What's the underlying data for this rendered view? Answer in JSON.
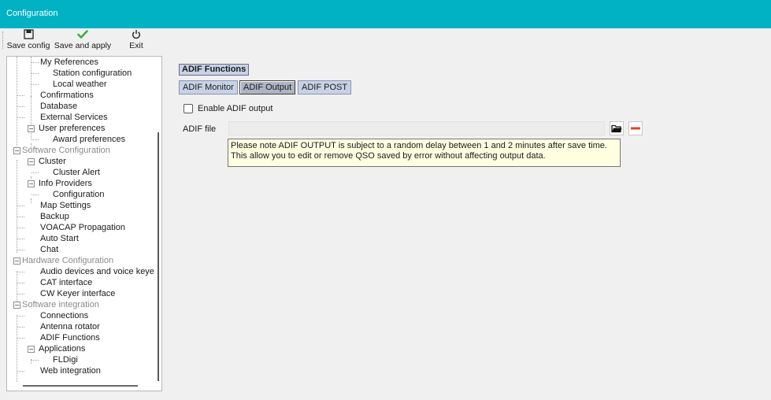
{
  "window": {
    "title": "Configuration"
  },
  "toolbar": {
    "buttons": [
      {
        "id": "save-config",
        "label": "Save config",
        "icon": "floppy-disk-icon"
      },
      {
        "id": "save-and-apply",
        "label": "Save and apply",
        "icon": "checkmark-icon"
      },
      {
        "id": "exit",
        "label": "Exit",
        "icon": "power-icon"
      }
    ]
  },
  "tree": {
    "nodes": [
      {
        "label": "My References",
        "level": 2
      },
      {
        "label": "Station configuration",
        "level": 2
      },
      {
        "label": "Local weather",
        "level": 2
      },
      {
        "label": "Confirmations",
        "level": 1
      },
      {
        "label": "Database",
        "level": 1
      },
      {
        "label": "External Services",
        "level": 1
      },
      {
        "label": "User preferences",
        "level": 1,
        "expanded": true
      },
      {
        "label": "Award preferences",
        "level": 2
      },
      {
        "label": "Software Configuration",
        "level": 0,
        "expanded": true,
        "muted": true
      },
      {
        "label": "Cluster",
        "level": 1,
        "expanded": true
      },
      {
        "label": "Cluster Alert",
        "level": 2
      },
      {
        "label": "Info Providers",
        "level": 1,
        "expanded": true
      },
      {
        "label": "Configuration",
        "level": 2
      },
      {
        "label": "Map Settings",
        "level": 1
      },
      {
        "label": "Backup",
        "level": 1
      },
      {
        "label": "VOACAP Propagation",
        "level": 1
      },
      {
        "label": "Auto Start",
        "level": 1
      },
      {
        "label": "Chat",
        "level": 1
      },
      {
        "label": "Hardware Configuration",
        "level": 0,
        "expanded": true,
        "muted": true
      },
      {
        "label": "Audio devices and voice keye",
        "level": 1
      },
      {
        "label": "CAT interface",
        "level": 1
      },
      {
        "label": "CW Keyer interface",
        "level": 1
      },
      {
        "label": "Software integration",
        "level": 0,
        "expanded": true,
        "muted": true
      },
      {
        "label": "Connections",
        "level": 1
      },
      {
        "label": "Antenna rotator",
        "level": 1
      },
      {
        "label": "ADIF Functions",
        "level": 1
      },
      {
        "label": "Applications",
        "level": 1,
        "expanded": true
      },
      {
        "label": "FLDigi",
        "level": 2
      },
      {
        "label": "Web integration",
        "level": 1
      }
    ]
  },
  "content": {
    "section_title": "ADIF Functions",
    "tabs": [
      {
        "label": "ADIF Monitor",
        "active": false
      },
      {
        "label": "ADIF Output",
        "active": true
      },
      {
        "label": "ADIF POST",
        "active": false
      }
    ],
    "enable_checkbox": {
      "label": "Enable ADIF output",
      "checked": false
    },
    "adif_file": {
      "label": "ADIF file",
      "value": ""
    },
    "note": {
      "line1": "Please note ADIF OUTPUT is subject to a random delay between 1 and 2 minutes after save time.",
      "line2": "This allow you to edit or remove QSO saved by error without affecting output data."
    }
  },
  "colors": {
    "titlebar": "#00b2c4",
    "tab_bg": "#c8d2e6",
    "note_bg": "#ffffe1",
    "checkmark": "#3cb043",
    "remove": "#e0452b"
  }
}
